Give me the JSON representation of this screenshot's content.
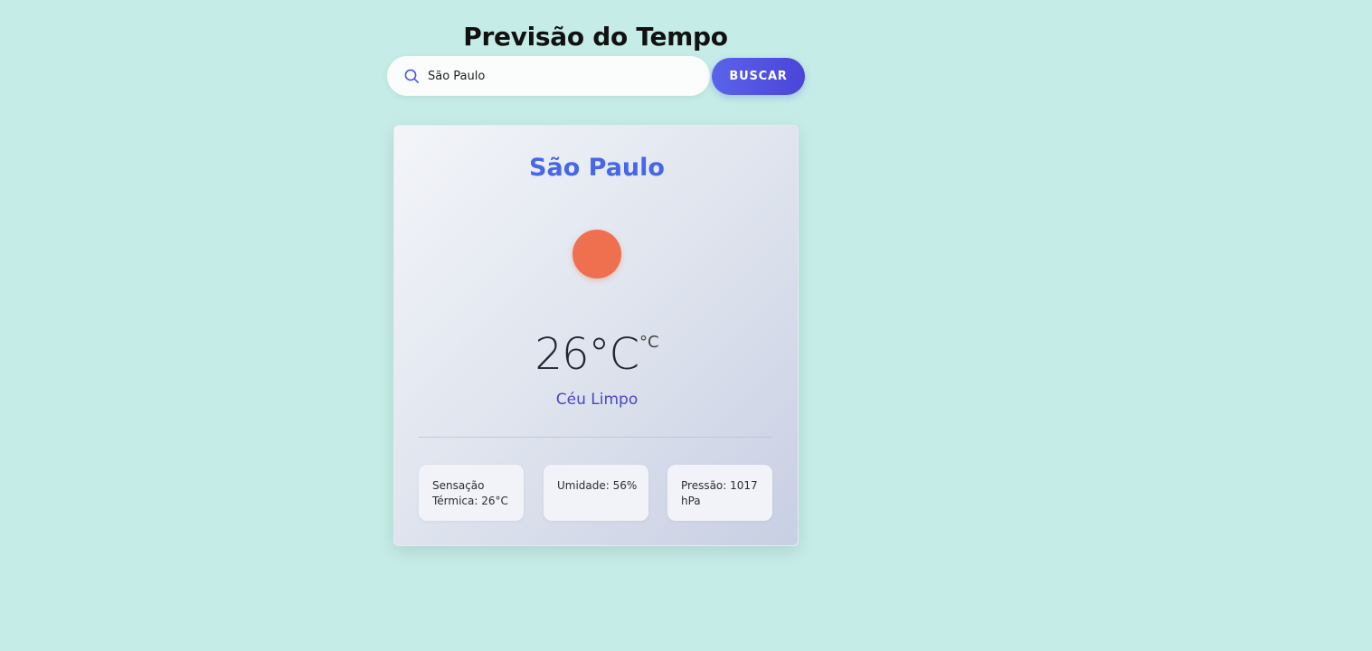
{
  "page": {
    "title": "Previsão do Tempo"
  },
  "search": {
    "value": "São Paulo",
    "button_label": "BUSCAR"
  },
  "weather": {
    "city": "São Paulo",
    "icon": "sun-icon",
    "temperature": "26°C",
    "unit": "°C",
    "description": "Céu Limpo",
    "details": {
      "feels_like": "Sensação Térmica: 26°C",
      "humidity": "Umidade: 56%",
      "pressure": "Pressão: 1017 hPa"
    }
  },
  "colors": {
    "background": "#c5ece7",
    "accent": "#4667e8",
    "button": "#5a63ea",
    "sun": "#ee704e"
  }
}
